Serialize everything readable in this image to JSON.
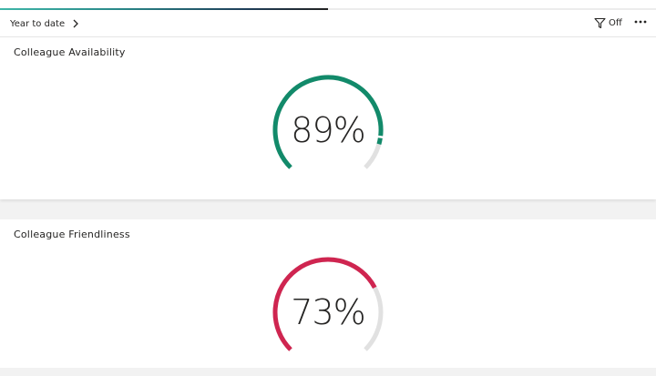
{
  "header": {
    "period_label": "Year to date",
    "filter_label": "Off",
    "accent_gradient": [
      "#3fb6a8",
      "#1f3f5a"
    ]
  },
  "cards": [
    {
      "title": "Colleague Availability",
      "value": 89,
      "value_label": "89%",
      "color": "#128a6a"
    },
    {
      "title": "Colleague Friendliness",
      "value": 73,
      "value_label": "73%",
      "color": "#cf2550"
    }
  ],
  "track_color": "#e1e1e1"
}
